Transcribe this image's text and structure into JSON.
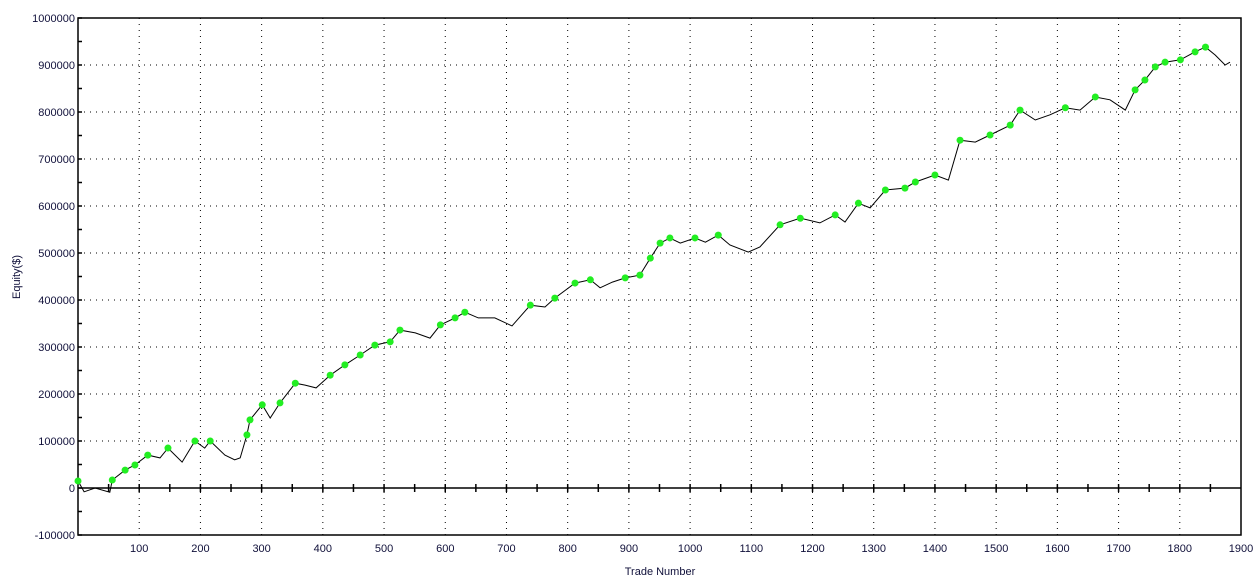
{
  "chart_data": {
    "type": "line",
    "title": "",
    "xlabel": "Trade Number",
    "ylabel": "Equity($)",
    "xlim": [
      0,
      1900
    ],
    "ylim": [
      -100000,
      1000000
    ],
    "grid": true,
    "legend": "none",
    "xticks": [
      "100",
      "200",
      "300",
      "400",
      "500",
      "600",
      "700",
      "800",
      "900",
      "1000",
      "1100",
      "1200",
      "1300",
      "1400",
      "1500",
      "1600",
      "1700",
      "1800",
      "1900"
    ],
    "yticks": [
      "1000000",
      "900000",
      "800000",
      "700000",
      "600000",
      "500000",
      "400000",
      "300000",
      "200000",
      "100000",
      "0",
      "-100000"
    ],
    "colors": {
      "line": "#000000",
      "new_high_marker": "#22ee22",
      "axis": "#000000"
    },
    "series": [
      {
        "name": "Equity",
        "x": [
          0,
          10,
          28,
          52,
          56,
          77,
          93,
          114,
          134,
          147,
          170,
          191,
          207,
          216,
          240,
          256,
          265,
          276,
          281,
          301,
          314,
          330,
          355,
          371,
          389,
          412,
          436,
          461,
          485,
          510,
          526,
          551,
          575,
          592,
          616,
          632,
          654,
          681,
          709,
          739,
          763,
          779,
          812,
          837,
          853,
          873,
          894,
          918,
          935,
          951,
          967,
          984,
          1008,
          1025,
          1046,
          1065,
          1095,
          1114,
          1147,
          1180,
          1212,
          1237,
          1253,
          1275,
          1294,
          1319,
          1351,
          1368,
          1400,
          1422,
          1441,
          1466,
          1490,
          1523,
          1539,
          1564,
          1588,
          1613,
          1637,
          1662,
          1686,
          1711,
          1727,
          1743,
          1760,
          1776,
          1801,
          1825,
          1842,
          1858,
          1874,
          1882
        ],
        "y": [
          15000,
          -8000,
          0,
          -9000,
          17000,
          38000,
          49000,
          70000,
          64000,
          85000,
          55000,
          100000,
          85000,
          100000,
          70000,
          60000,
          64000,
          113000,
          145000,
          177000,
          149000,
          181000,
          223000,
          219000,
          213000,
          240000,
          262000,
          283000,
          304000,
          311000,
          336000,
          330000,
          319000,
          347000,
          362000,
          374000,
          362000,
          362000,
          345000,
          389000,
          385000,
          404000,
          436000,
          443000,
          426000,
          438000,
          447000,
          453000,
          489000,
          521000,
          532000,
          521000,
          532000,
          523000,
          538000,
          517000,
          502000,
          513000,
          560000,
          574000,
          564000,
          581000,
          566000,
          606000,
          596000,
          634000,
          638000,
          651000,
          666000,
          655000,
          740000,
          736000,
          751000,
          772000,
          804000,
          783000,
          794000,
          809000,
          804000,
          832000,
          826000,
          804000,
          847000,
          868000,
          896000,
          906000,
          911000,
          928000,
          938000,
          921000,
          900000,
          906000
        ]
      }
    ]
  }
}
